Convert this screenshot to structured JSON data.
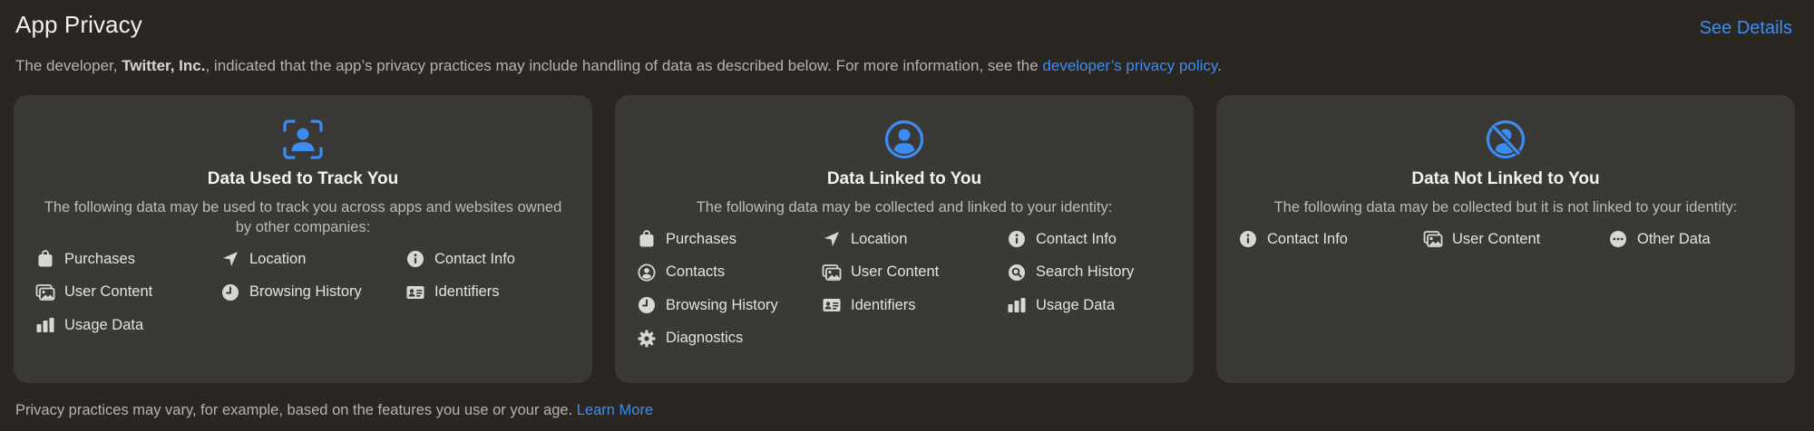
{
  "header": {
    "title": "App Privacy",
    "see_details": "See Details"
  },
  "intro": {
    "prefix": "The developer, ",
    "developer": "Twitter, Inc.",
    "middle": ", indicated that the app’s privacy practices may include handling of data as described below. For more information, see the ",
    "link": "developer’s privacy policy",
    "suffix": "."
  },
  "cards": [
    {
      "icon": "tracking-icon",
      "title": "Data Used to Track You",
      "description": "The following data may be used to track you across apps and websites owned by other companies:",
      "items": [
        {
          "label": "Purchases",
          "icon": "bag-icon"
        },
        {
          "label": "Location",
          "icon": "location-arrow-icon"
        },
        {
          "label": "Contact Info",
          "icon": "info-icon"
        },
        {
          "label": "User Content",
          "icon": "photos-icon"
        },
        {
          "label": "Browsing History",
          "icon": "clock-icon"
        },
        {
          "label": "Identifiers",
          "icon": "id-card-icon"
        },
        {
          "label": "Usage Data",
          "icon": "bar-chart-icon"
        }
      ]
    },
    {
      "icon": "person-circle-icon",
      "title": "Data Linked to You",
      "description": "The following data may be collected and linked to your identity:",
      "items": [
        {
          "label": "Purchases",
          "icon": "bag-icon"
        },
        {
          "label": "Location",
          "icon": "location-arrow-icon"
        },
        {
          "label": "Contact Info",
          "icon": "info-icon"
        },
        {
          "label": "Contacts",
          "icon": "contacts-icon"
        },
        {
          "label": "User Content",
          "icon": "photos-icon"
        },
        {
          "label": "Search History",
          "icon": "search-circle-icon"
        },
        {
          "label": "Browsing History",
          "icon": "clock-icon"
        },
        {
          "label": "Identifiers",
          "icon": "id-card-icon"
        },
        {
          "label": "Usage Data",
          "icon": "bar-chart-icon"
        },
        {
          "label": "Diagnostics",
          "icon": "gear-icon"
        }
      ]
    },
    {
      "icon": "person-slash-icon",
      "title": "Data Not Linked to You",
      "description": "The following data may be collected but it is not linked to your identity:",
      "items": [
        {
          "label": "Contact Info",
          "icon": "info-icon"
        },
        {
          "label": "User Content",
          "icon": "photos-icon"
        },
        {
          "label": "Other Data",
          "icon": "ellipsis-icon"
        }
      ]
    }
  ],
  "footer": {
    "text": "Privacy practices may vary, for example, based on the features you use or your age. ",
    "link": "Learn More"
  },
  "colors": {
    "accent": "#3b8cf5",
    "background": "#2a2722",
    "card": "#3b3935"
  }
}
